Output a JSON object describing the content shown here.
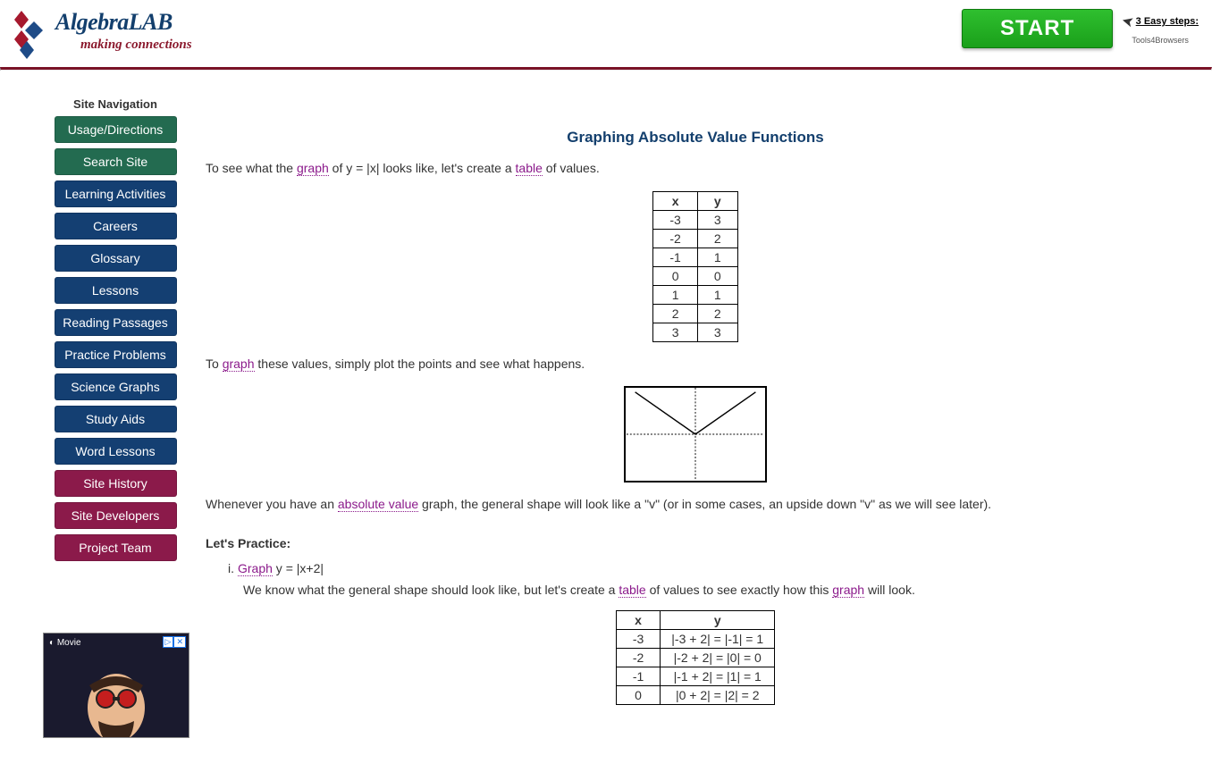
{
  "header": {
    "logo_title": "AlgebraLAB",
    "logo_subtitle": "making connections",
    "start_button": "START",
    "easy_steps_link": "3 Easy steps:",
    "easy_steps_sub": "Tools4Browsers"
  },
  "sidebar": {
    "title": "Site Navigation",
    "items": [
      {
        "label": "Usage/Directions",
        "style": "green"
      },
      {
        "label": "Search Site",
        "style": "green"
      },
      {
        "label": "Learning Activities",
        "style": "blue"
      },
      {
        "label": "Careers",
        "style": "blue"
      },
      {
        "label": "Glossary",
        "style": "blue"
      },
      {
        "label": "Lessons",
        "style": "blue"
      },
      {
        "label": "Reading Passages",
        "style": "blue"
      },
      {
        "label": "Practice Problems",
        "style": "blue"
      },
      {
        "label": "Science Graphs",
        "style": "blue"
      },
      {
        "label": "Study Aids",
        "style": "blue"
      },
      {
        "label": "Word Lessons",
        "style": "blue"
      },
      {
        "label": "Site History",
        "style": "maroon"
      },
      {
        "label": "Site Developers",
        "style": "maroon"
      },
      {
        "label": "Project Team",
        "style": "maroon"
      }
    ],
    "ad": {
      "label": "Movie",
      "ad_tag1": "▷",
      "ad_tag2": "✕"
    }
  },
  "content": {
    "title": "Graphing Absolute Value Functions",
    "intro_pre": "To see what the ",
    "term_graph": "graph",
    "intro_mid": " of y = |x| looks like, let's create a ",
    "term_table": "table",
    "intro_post": " of values.",
    "table1": {
      "headers": [
        "x",
        "y"
      ],
      "rows": [
        [
          "-3",
          "3"
        ],
        [
          "-2",
          "2"
        ],
        [
          "-1",
          "1"
        ],
        [
          "0",
          "0"
        ],
        [
          "1",
          "1"
        ],
        [
          "2",
          "2"
        ],
        [
          "3",
          "3"
        ]
      ]
    },
    "plot_pre": "To ",
    "plot_post": " these values, simply plot the points and see what happens.",
    "whenever_pre": "Whenever you have an ",
    "term_absolute": "absolute value",
    "whenever_post": " graph, the general shape will look like a \"v\" (or in some cases, an upside down \"v\" as we will see later).",
    "practice_header": "Let's Practice:",
    "practice_i_num": "i.",
    "term_graph_cap": "Graph",
    "practice_i_eq": " y = |x+2|",
    "practice_i_desc_pre": "We know what the general shape should look like, but let's create a ",
    "practice_i_desc_mid": " of values to see exactly how this ",
    "practice_i_desc_post": " will look.",
    "table2": {
      "headers": [
        "x",
        "y"
      ],
      "rows": [
        [
          "-3",
          "|-3 + 2| = |-1| = 1"
        ],
        [
          "-2",
          "|-2 + 2| = |0| = 0"
        ],
        [
          "-1",
          "|-1 + 2| = |1| = 1"
        ],
        [
          "0",
          "|0 + 2| = |2| = 2"
        ]
      ]
    }
  }
}
